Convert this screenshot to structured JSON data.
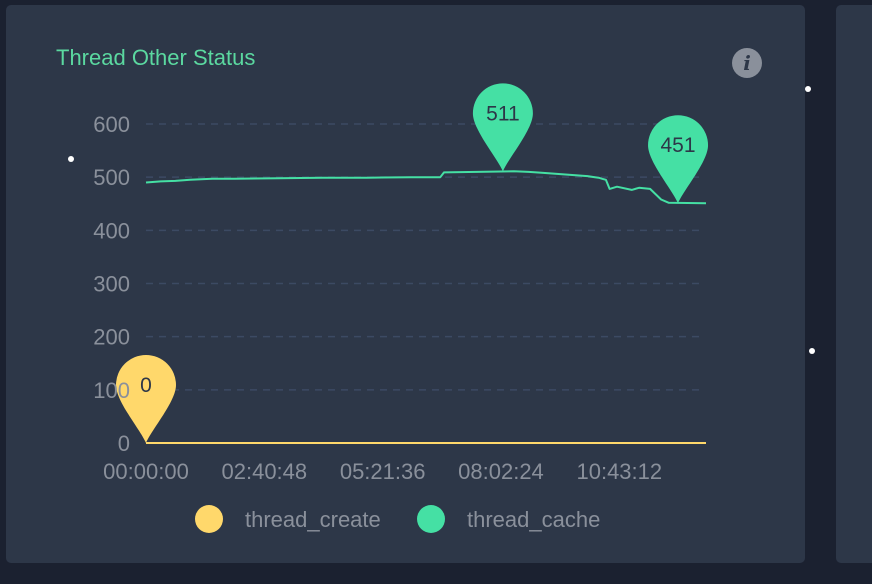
{
  "panel": {
    "title": "Thread Other Status"
  },
  "icons": {
    "info": "info-icon",
    "info_glyph": "i"
  },
  "colors": {
    "background": "#1b2130",
    "panel": "#2d3748",
    "title": "#5bd8a0",
    "thread_create": "#ffd86b",
    "thread_cache": "#45e0a4",
    "grid": "#3c4a63",
    "text": "#8a909b"
  },
  "chart_data": {
    "type": "line",
    "title": "Thread Other Status",
    "xlabel": "",
    "ylabel": "",
    "ylim": [
      0,
      600
    ],
    "y_ticks": [
      0,
      100,
      200,
      300,
      400,
      500,
      600
    ],
    "y_tick_labels": [
      "0",
      "100",
      "200",
      "300",
      "400",
      "500",
      "600"
    ],
    "x_tick_labels": [
      "00:00:00",
      "02:40:48",
      "05:21:36",
      "08:02:24",
      "10:43:12"
    ],
    "grid": true,
    "legend_position": "bottom",
    "series": [
      {
        "name": "thread_create",
        "color": "#ffd86b",
        "x": [
          "00:00:00",
          "12:41:00"
        ],
        "values": [
          0,
          0
        ],
        "markers": [
          {
            "x": "00:00:00",
            "value": 0,
            "label": "0"
          }
        ]
      },
      {
        "name": "thread_cache",
        "color": "#45e0a4",
        "x": [
          "00:00:00",
          "00:20:00",
          "00:40:00",
          "01:00:00",
          "01:30:00",
          "02:00:00",
          "03:00:00",
          "04:00:00",
          "05:00:00",
          "06:00:00",
          "06:40:00",
          "06:45:00",
          "07:30:00",
          "08:20:00",
          "08:40:00",
          "09:00:00",
          "09:30:00",
          "10:00:00",
          "10:10:00",
          "10:15:00",
          "10:20:00",
          "10:25:00",
          "10:30:00",
          "10:40:00",
          "11:00:00",
          "11:10:00",
          "11:25:00",
          "11:40:00",
          "11:50:00",
          "12:41:00"
        ],
        "values": [
          490,
          492,
          493,
          495,
          497,
          497,
          498,
          499,
          499,
          500,
          500,
          509,
          510,
          511,
          510,
          508,
          505,
          502,
          500,
          499,
          497,
          495,
          478,
          482,
          476,
          480,
          478,
          458,
          452,
          451
        ],
        "markers": [
          {
            "x": "08:05:00",
            "value": 511,
            "label": "511"
          },
          {
            "x": "12:03:00",
            "value": 451,
            "label": "451"
          }
        ]
      }
    ]
  }
}
